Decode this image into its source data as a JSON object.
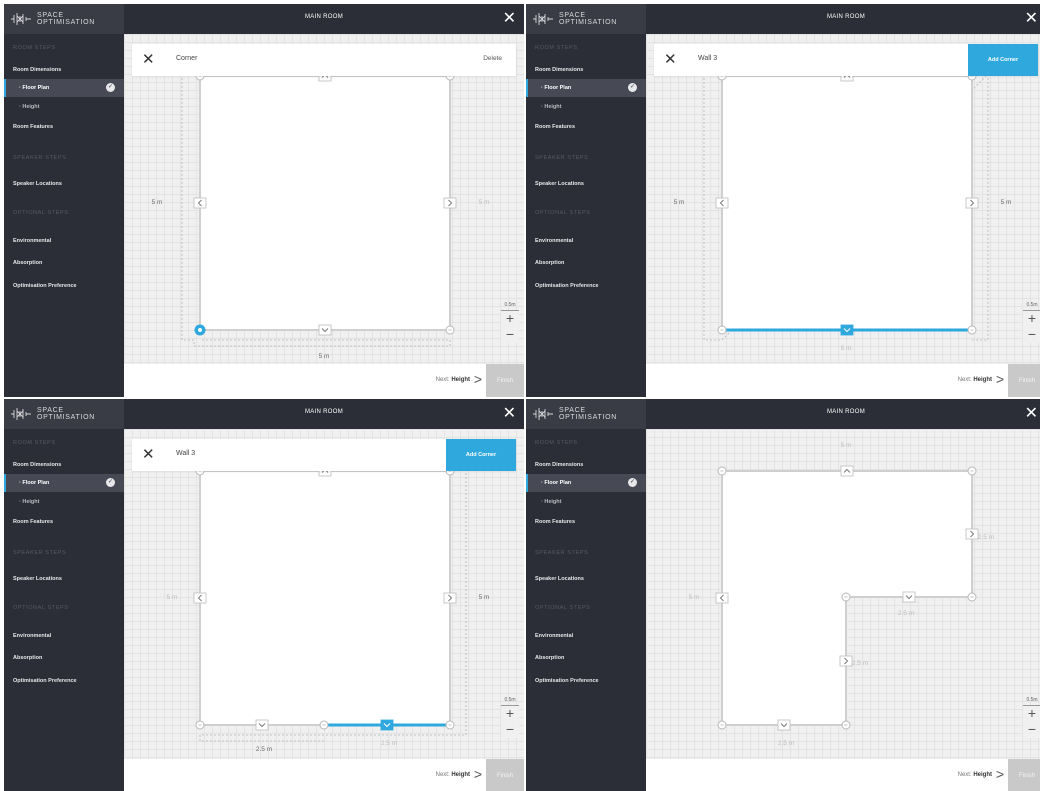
{
  "brand": {
    "line1": "SPACE",
    "line2": "OPTIMISATION"
  },
  "nav": [
    {
      "label": "ROOM STEPS",
      "type": "heading"
    },
    {
      "label": "Room Dimensions",
      "type": "item"
    },
    {
      "label": "· Floor Plan",
      "type": "active"
    },
    {
      "label": "· Height",
      "type": "sub"
    },
    {
      "label": "Room Features",
      "type": "item"
    },
    {
      "label": "SPEAKER STEPS",
      "type": "heading"
    },
    {
      "label": "Speaker Locations",
      "type": "item"
    },
    {
      "label": "OPTIONAL STEPS",
      "type": "heading"
    },
    {
      "label": "Environmental",
      "type": "item"
    },
    {
      "label": "Absorption",
      "type": "item"
    },
    {
      "label": "Optimisation Preference",
      "type": "item"
    }
  ],
  "panels": [
    {
      "room_title": "MAIN ROOM",
      "toolbar": {
        "label": "Corner",
        "action": "Delete",
        "action_style": "text"
      },
      "dimensions": [
        "5 m",
        "5 m",
        "5 m"
      ],
      "zoom": {
        "scale": "0.5m",
        "plus": "+",
        "minus": "−"
      },
      "footer": {
        "next_prefix": "Next:",
        "next_target": "Height",
        "finish": "Finish"
      }
    },
    {
      "room_title": "MAIN ROOM",
      "toolbar": {
        "label": "Wall 3",
        "action": "Add Corner",
        "action_style": "button"
      },
      "dimensions": [
        "5 m",
        "5 m",
        "5 m"
      ],
      "zoom": {
        "scale": "0.5m",
        "plus": "+",
        "minus": "−"
      },
      "footer": {
        "next_prefix": "Next:",
        "next_target": "Height",
        "finish": "Finish"
      }
    },
    {
      "room_title": "MAIN ROOM",
      "toolbar": {
        "label": "Wall 3",
        "action": "Add Corner",
        "action_style": "button"
      },
      "dimensions": [
        "5 m",
        "5 m",
        "2.5 m",
        "2.5 m"
      ],
      "zoom": {
        "scale": "0.5m",
        "plus": "+",
        "minus": "−"
      },
      "footer": {
        "next_prefix": "Next:",
        "next_target": "Height",
        "finish": "Finish"
      }
    },
    {
      "room_title": "MAIN ROOM",
      "toolbar": null,
      "dimensions": [
        "5 m",
        "5 m",
        "2.5 m",
        "2.5 m",
        "2.5 m",
        "2.5 m"
      ],
      "zoom": {
        "scale": "0.5m",
        "plus": "+",
        "minus": "−"
      },
      "footer": {
        "next_prefix": "Next:",
        "next_target": "Height",
        "finish": "Finish"
      }
    }
  ],
  "colors": {
    "sidebar": "#2c2e37",
    "accent": "#2fa8de",
    "finish_disabled": "#c9c9c9",
    "grid": "#e3e3e3"
  }
}
